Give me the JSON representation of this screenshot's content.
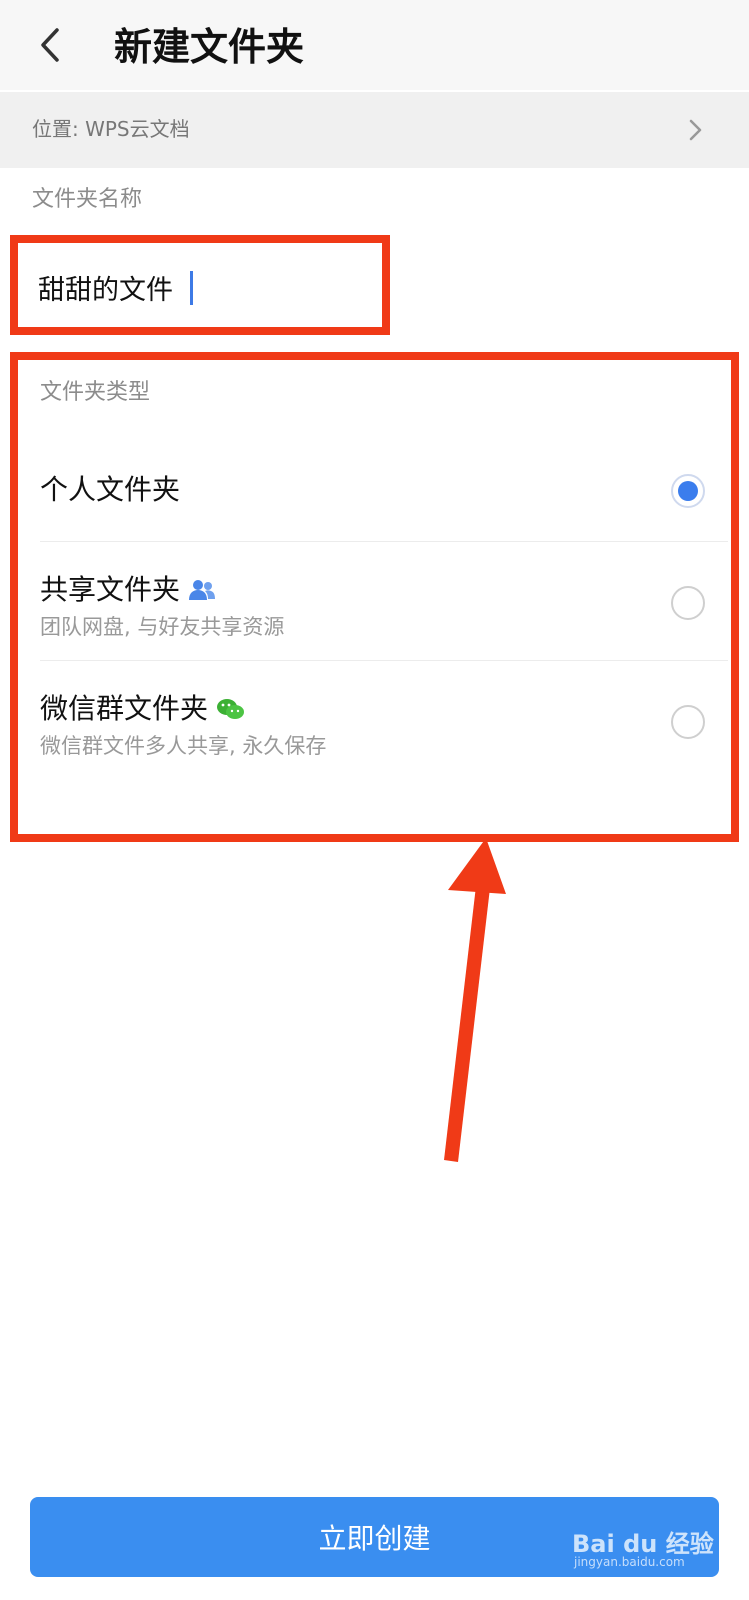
{
  "header": {
    "title": "新建文件夹"
  },
  "location": {
    "label": "位置: WPS云文档"
  },
  "name_section": {
    "label": "文件夹名称",
    "value": "甜甜的文件"
  },
  "type_section": {
    "label": "文件夹类型",
    "options": [
      {
        "title": "个人文件夹",
        "subtitle": "",
        "selected": true
      },
      {
        "title": "共享文件夹",
        "subtitle": "团队网盘, 与好友共享资源",
        "selected": false,
        "icon": "people-icon"
      },
      {
        "title": "微信群文件夹",
        "subtitle": "微信群文件多人共享, 永久保存",
        "selected": false,
        "icon": "wechat-icon"
      }
    ]
  },
  "actions": {
    "create_label": "立即创建"
  },
  "watermark": {
    "brand": "Bai du 经验",
    "url": "jingyan.baidu.com"
  },
  "colors": {
    "accent": "#3a8ef0",
    "radio_selected": "#3b7ded",
    "annotation": "#f03a17",
    "wechat_green": "#3cb034"
  }
}
